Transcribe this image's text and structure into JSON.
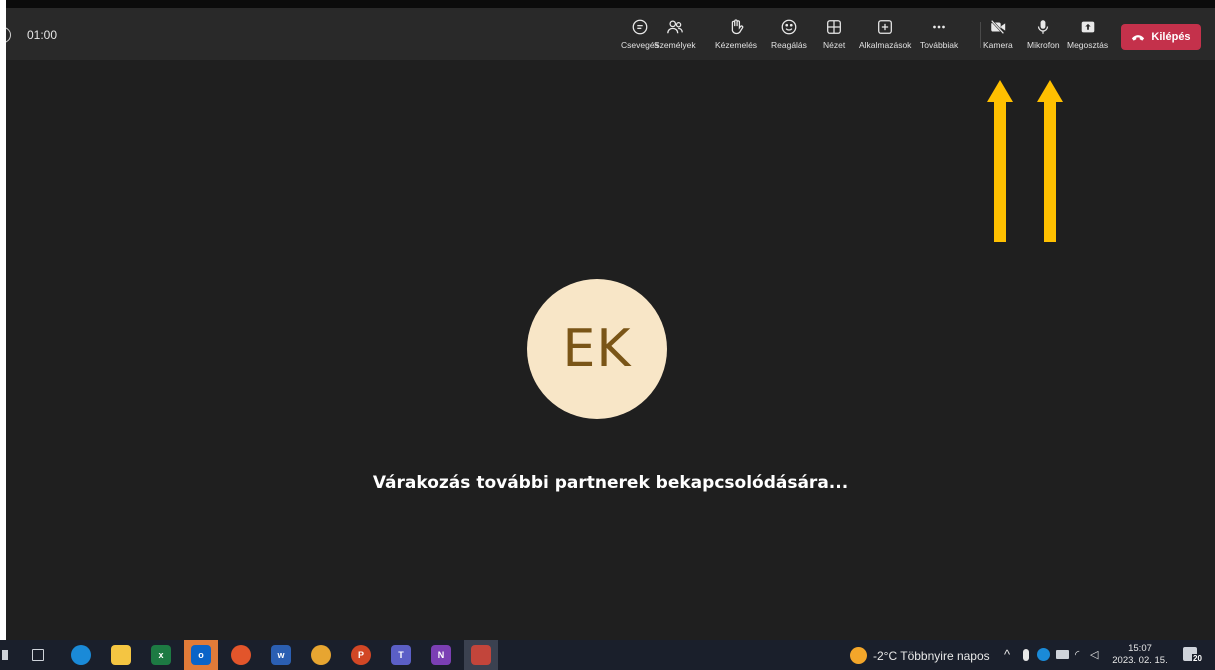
{
  "meeting": {
    "timer": "01:00",
    "toolbar": [
      {
        "name": "chat",
        "label": "Csevegés",
        "icon": "chat-bubble-icon"
      },
      {
        "name": "people",
        "label": "Személyek",
        "icon": "people-icon"
      },
      {
        "name": "raise-hand",
        "label": "Kézemelés",
        "icon": "hand-icon"
      },
      {
        "name": "react",
        "label": "Reagálás",
        "icon": "smiley-icon"
      },
      {
        "name": "view",
        "label": "Nézet",
        "icon": "grid-icon"
      },
      {
        "name": "apps",
        "label": "Alkalmazások",
        "icon": "plus-square-icon"
      },
      {
        "name": "more",
        "label": "Továbbiak",
        "icon": "more-dots-icon"
      },
      {
        "name": "camera",
        "label": "Kamera",
        "icon": "camera-off-icon"
      },
      {
        "name": "microphone",
        "label": "Mikrofon",
        "icon": "microphone-icon"
      },
      {
        "name": "share",
        "label": "Megosztás",
        "icon": "share-icon"
      }
    ],
    "leave_label": "Kilépés",
    "avatar_initials": "EK",
    "waiting_message": "Várakozás további partnerek bekapcsolódására..."
  },
  "colors": {
    "stage": "#1f1f1f",
    "toolbar": "#292929",
    "leave": "#c4314b",
    "avatar_bg": "#f8e6c7",
    "avatar_text": "#7a5517",
    "arrow": "#ffc000"
  },
  "taskbar": {
    "apps": [
      "task-view-icon",
      "edge-icon",
      "file-explorer-icon",
      "excel-icon",
      "outlook-icon",
      "firefox-icon",
      "word-icon",
      "chrome-icon",
      "powerpoint-icon",
      "teams-icon",
      "onenote-icon",
      "app-icon"
    ],
    "weather": "-2°C  Többnyire napos",
    "time": "15:07",
    "date": "2023. 02. 15.",
    "notification_count": "20"
  }
}
